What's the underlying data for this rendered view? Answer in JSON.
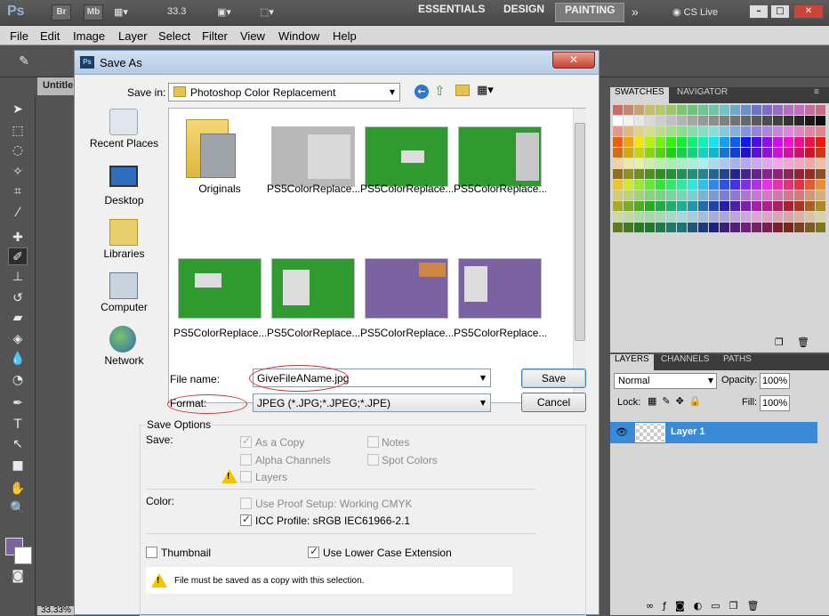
{
  "app": {
    "workspaces": [
      "ESSENTIALS",
      "DESIGN",
      "PAINTING"
    ],
    "active_workspace": "PAINTING",
    "cs_live": "CS Live",
    "zoom_value": "33.3",
    "bridge_label": "Br",
    "minibridge_label": "Mb",
    "doc_tab": "Untitle",
    "zoom_status": "33.33%"
  },
  "menu": [
    "File",
    "Edit",
    "Image",
    "Layer",
    "Select",
    "Filter",
    "View",
    "Window",
    "Help"
  ],
  "dialog": {
    "title": "Save As",
    "save_in_label": "Save in:",
    "save_in_value": "Photoshop  Color Replacement",
    "places": [
      "Recent Places",
      "Desktop",
      "Libraries",
      "Computer",
      "Network"
    ],
    "files": [
      {
        "name": "Originals",
        "kind": "folder"
      },
      {
        "name": "PS5ColorReplace...",
        "kind": "image"
      },
      {
        "name": "PS5ColorReplace...",
        "kind": "image"
      },
      {
        "name": "PS5ColorReplace...",
        "kind": "image"
      },
      {
        "name": "PS5ColorReplace...",
        "kind": "image"
      },
      {
        "name": "PS5ColorReplace...",
        "kind": "image"
      },
      {
        "name": "PS5ColorReplace...",
        "kind": "image"
      },
      {
        "name": "PS5ColorReplace...",
        "kind": "image"
      }
    ],
    "file_name_label": "File name:",
    "file_name_value": "GiveFileAName.jpg",
    "format_label": "Format:",
    "format_value": "JPEG (*.JPG;*.JPEG;*.JPE)",
    "save_button": "Save",
    "cancel_button": "Cancel",
    "save_options_label": "Save Options",
    "save_label": "Save:",
    "as_a_copy": "As a Copy",
    "notes": "Notes",
    "alpha_channels": "Alpha Channels",
    "spot_colors": "Spot Colors",
    "layers": "Layers",
    "color_label": "Color:",
    "use_proof_setup": "Use Proof Setup:  Working CMYK",
    "icc_profile": "ICC Profile:  sRGB IEC61966-2.1",
    "thumbnail": "Thumbnail",
    "lower_case_ext": "Use Lower Case Extension",
    "warning_text": "File must be saved as a copy with this selection."
  },
  "panels": {
    "swatches_tabs": [
      "SWATCHES",
      "NAVIGATOR"
    ],
    "layers_tabs": [
      "LAYERS",
      "CHANNELS",
      "PATHS"
    ],
    "blend_mode": "Normal",
    "opacity_label": "Opacity:",
    "opacity_value": "100%",
    "lock_label": "Lock:",
    "fill_label": "Fill:",
    "fill_value": "100%",
    "layer_name": "Layer 1"
  },
  "colors": {
    "foreground": "#7b62a3",
    "background": "#ffffff",
    "annotation": "#d23030",
    "selection": "#3a8ad8"
  }
}
